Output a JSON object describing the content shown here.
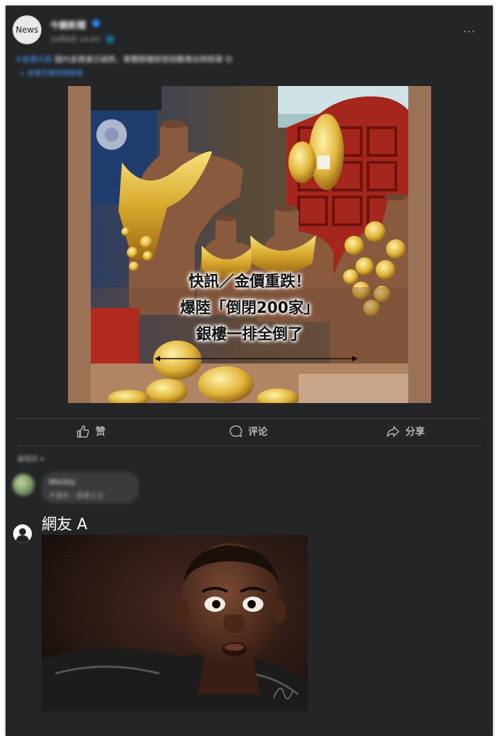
{
  "post": {
    "avatar_text": "News",
    "page_name": "今鏡新聞",
    "meta": "10月8日 14:43 · 🌐",
    "more": "···",
    "text_tag": "#金價大跌",
    "text_body": " 國內金價連日崩跌，實體銀樓經營困難傳出倒閉潮 😢",
    "link_text": "↳ 查看完整新聞報導"
  },
  "photo": {
    "headline_lines": [
      "快訊／金價重跌！",
      "爆陸「倒閉200家」",
      "銀樓一排全倒了"
    ]
  },
  "actions": {
    "like_label": "赞",
    "comment_label": "评论",
    "share_label": "分享"
  },
  "comments": {
    "sort_label": "最相关 ▾",
    "first": {
      "name": "Wesley",
      "text": "不意外・很會工立"
    },
    "second": {
      "name": "網友 A"
    }
  },
  "colors": {
    "card_bg": "#242526",
    "text_primary": "#e4e6eb",
    "text_secondary": "#b0b3b8",
    "link_blue": "#4599ff",
    "divider": "#3e4042"
  },
  "icons": [
    "like-icon",
    "comment-icon",
    "share-icon",
    "default-avatar-icon",
    "verified-icon"
  ]
}
